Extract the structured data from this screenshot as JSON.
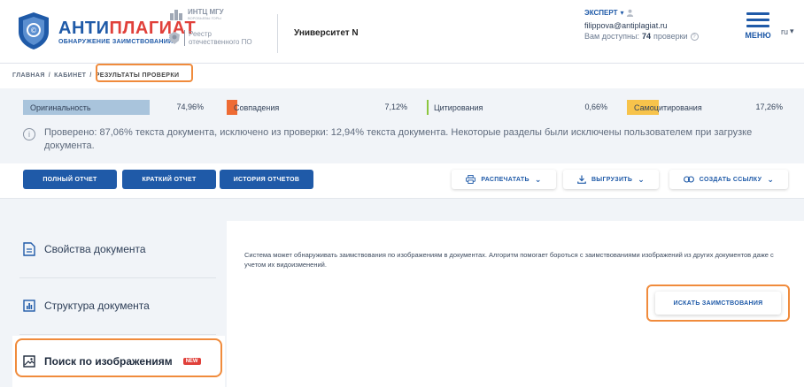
{
  "brand": {
    "name_blue": "АНТИ",
    "name_red": "ПЛАГИАТ",
    "subtitle": "ОБНАРУЖЕНИЕ ЗАИМСТВОВАНИЙ",
    "color_blue": "#1f5aa8",
    "color_red": "#e0403a"
  },
  "partners": {
    "p1_title": "ИНТЦ МГУ",
    "p1_sub": "ВОРОБЬЕВЫ ГОРЫ",
    "p2_line1": "Реестр",
    "p2_line2": "отечественного ПО"
  },
  "university": "Университет N",
  "user": {
    "role": "ЭКСПЕРТ",
    "email": "filippova@antiplagiat.ru",
    "available_prefix": "Вам доступны:",
    "available_count": "74",
    "available_suffix": "проверки"
  },
  "menu_label": "МЕНЮ",
  "lang": "ru",
  "breadcrumb": {
    "home": "ГЛАВНАЯ",
    "cabinet": "КАБИНЕТ",
    "current": "РЕЗУЛЬТАТЫ ПРОВЕРКИ",
    "sep": "/"
  },
  "stats": [
    {
      "label": "Оригинальность",
      "value": "74,96%",
      "color": "#a9c4dc"
    },
    {
      "label": "Совпадения",
      "value": "7,12%",
      "color": "#ee6b34"
    },
    {
      "label": "Цитирования",
      "value": "0,66%",
      "color": "#8cc63f"
    },
    {
      "label": "Самоцитирования",
      "value": "17,26%",
      "color": "#f7c34b"
    }
  ],
  "info_text": "Проверено: 87,06% текста документа, исключено из проверки: 12,94% текста документа. Некоторые разделы были исключены пользователем при загрузке документа.",
  "toolbar": {
    "full_report": "ПОЛНЫЙ ОТЧЕТ",
    "short_report": "КРАТКИЙ ОТЧЕТ",
    "history": "ИСТОРИЯ ОТЧЕТОВ",
    "print": "РАСПЕЧАТАТЬ",
    "export": "ВЫГРУЗИТЬ",
    "link": "СОЗДАТЬ ССЫЛКУ"
  },
  "sidebar": {
    "items": [
      {
        "label": "Свойства документа",
        "icon": "document-icon"
      },
      {
        "label": "Структура документа",
        "icon": "structure-icon"
      },
      {
        "label": "Поиск по изображениям",
        "icon": "image-icon",
        "badge": "NEW"
      }
    ]
  },
  "main": {
    "description": "Система может обнаруживать заимствования по изображениям в документах. Алгоритм помогает бороться с заимствованиями изображений из других документов даже с учетом их видоизменений.",
    "search_button": "ИСКАТЬ ЗАИМСТВОВАНИЯ"
  }
}
